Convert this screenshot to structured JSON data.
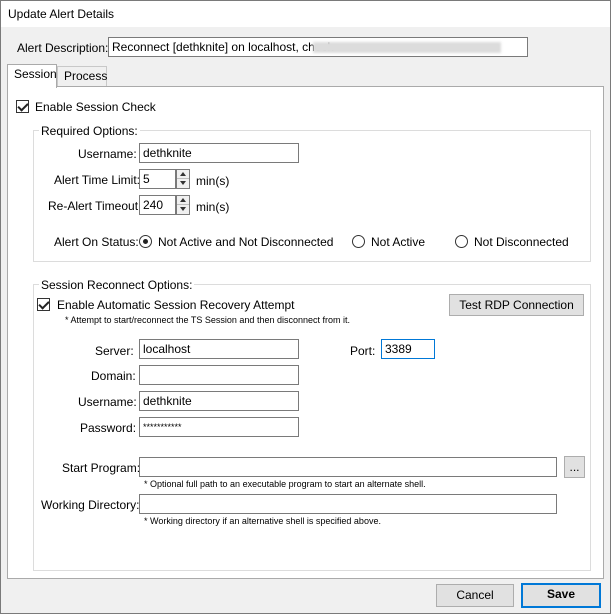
{
  "window": {
    "title": "Update Alert Details"
  },
  "alert_description": {
    "label": "Alert Description:",
    "value": "Reconnect [dethknite] on localhost, check"
  },
  "tabs": [
    {
      "label": "Session",
      "active": true
    },
    {
      "label": "Process",
      "active": false
    }
  ],
  "session": {
    "enable_check_label": "Enable Session Check",
    "enable_checked": true,
    "required": {
      "legend": "Required Options:",
      "username_label": "Username:",
      "username_value": "dethknite",
      "time_limit_label": "Alert Time Limit:",
      "time_limit_value": "5",
      "time_limit_unit": "min(s)",
      "realert_label": "Re-Alert Timeout:",
      "realert_value": "240",
      "realert_unit": "min(s)",
      "status_label": "Alert On Status:",
      "status_options": [
        {
          "label": "Not Active and Not Disconnected",
          "checked": true
        },
        {
          "label": "Not Active",
          "checked": false
        },
        {
          "label": "Not Disconnected",
          "checked": false
        }
      ]
    },
    "reconnect": {
      "legend": "Session Reconnect Options:",
      "auto_recovery_label": "Enable Automatic Session Recovery Attempt",
      "auto_recovery_checked": true,
      "auto_recovery_note": "* Attempt to start/reconnect the TS Session and then disconnect from it.",
      "test_button": "Test RDP Connection",
      "server_label": "Server:",
      "server_value": "localhost",
      "port_label": "Port:",
      "port_value": "3389",
      "domain_label": "Domain:",
      "domain_value": "",
      "username_label": "Username:",
      "username_value": "dethknite",
      "password_label": "Password:",
      "password_value": "***********",
      "start_program_label": "Start Program:",
      "start_program_value": "",
      "browse_button": "...",
      "start_program_note": "* Optional full path to an executable program to start an alternate shell.",
      "working_dir_label": "Working Directory:",
      "working_dir_value": "",
      "working_dir_note": "* Working directory if an alternative shell is specified above."
    }
  },
  "footer": {
    "cancel_label": "Cancel",
    "save_label": "Save"
  },
  "colors": {
    "focus_border": "#0078d7",
    "window_bg": "#f0f0f0",
    "panel_bg": "#ffffff"
  }
}
